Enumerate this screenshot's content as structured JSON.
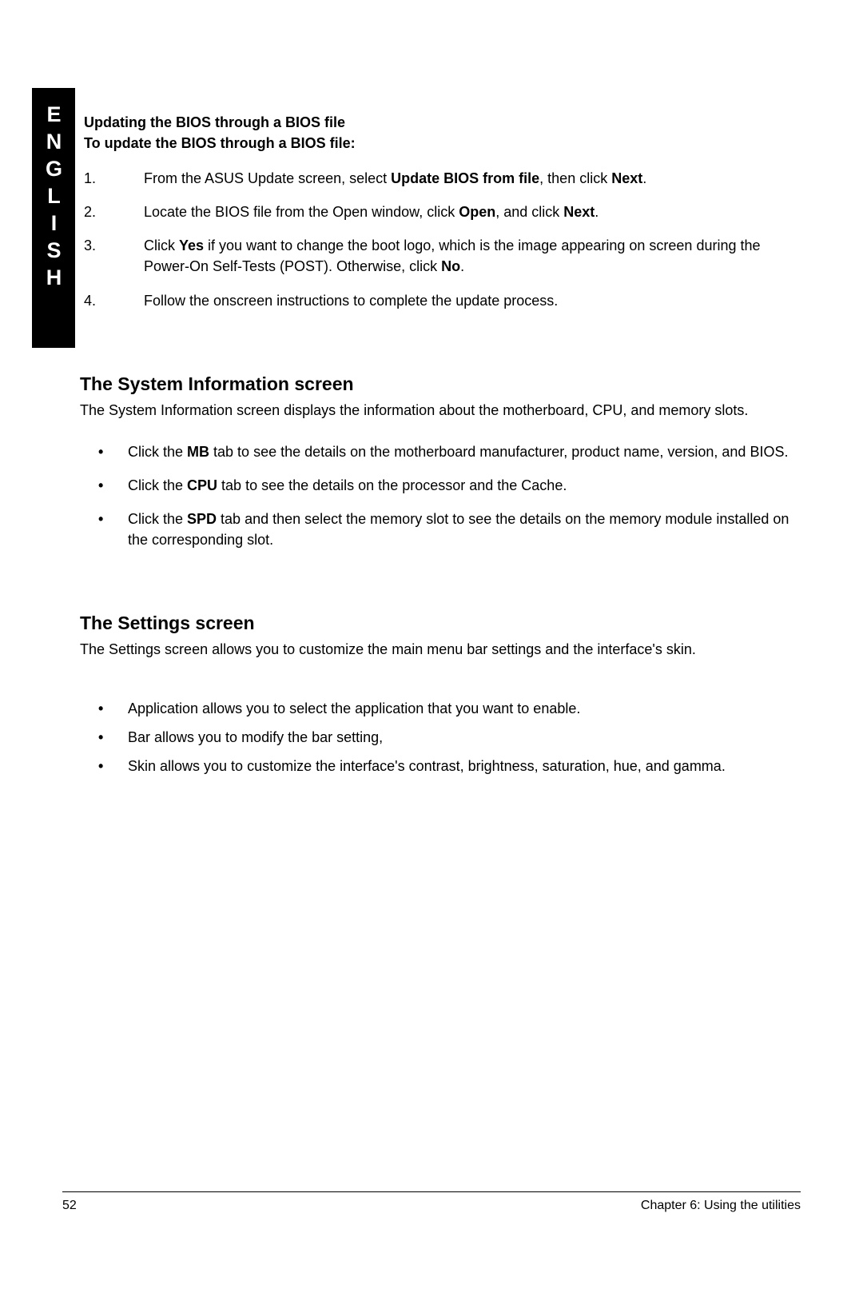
{
  "side_tab": "ENGLISH",
  "section_bios": {
    "title1": "Updating the BIOS through a BIOS file",
    "title2": "To update the BIOS through a BIOS file:",
    "steps": [
      {
        "num": "1.",
        "pre": "From the ASUS Update screen, select ",
        "b1": "Update BIOS from file",
        "mid": ", then click ",
        "b2": "Next",
        "post": "."
      },
      {
        "num": "2.",
        "pre": "Locate the BIOS file from the Open window, click ",
        "b1": "Open",
        "mid": ", and click ",
        "b2": "Next",
        "post": "."
      },
      {
        "num": "3.",
        "pre": "Click ",
        "b1": "Yes",
        "mid": " if you want to change the boot logo, which is the image appearing on screen during the Power-On Self-Tests (POST). Otherwise, click ",
        "b2": "No",
        "post": "."
      },
      {
        "num": "4.",
        "pre": "Follow the onscreen instructions to complete the update process.",
        "b1": "",
        "mid": "",
        "b2": "",
        "post": ""
      }
    ]
  },
  "section_sysinfo": {
    "heading": "The System Information screen",
    "intro": "The System Information screen displays the information about the motherboard, CPU, and memory slots.",
    "items": [
      {
        "pre": "Click the ",
        "b": "MB",
        "post": " tab to see the details on the motherboard manufacturer, product name, version, and BIOS."
      },
      {
        "pre": "Click the ",
        "b": "CPU",
        "post": " tab to see the details on the processor and the Cache."
      },
      {
        "pre": "Click the ",
        "b": "SPD",
        "post": " tab and then select the memory slot to see the details on the memory module installed on the corresponding slot."
      }
    ]
  },
  "section_settings": {
    "heading": "The Settings screen",
    "intro": "The Settings screen allows you to customize the main menu bar settings and the interface's skin.",
    "items": [
      {
        "text": "Application allows you to select the application that you want to enable."
      },
      {
        "text": "Bar allows you to modify the bar setting,"
      },
      {
        "text": "Skin allows you to customize the interface's contrast, brightness, saturation, hue, and gamma."
      }
    ]
  },
  "footer": {
    "page": "52",
    "chapter": "Chapter 6: Using the utilities"
  }
}
